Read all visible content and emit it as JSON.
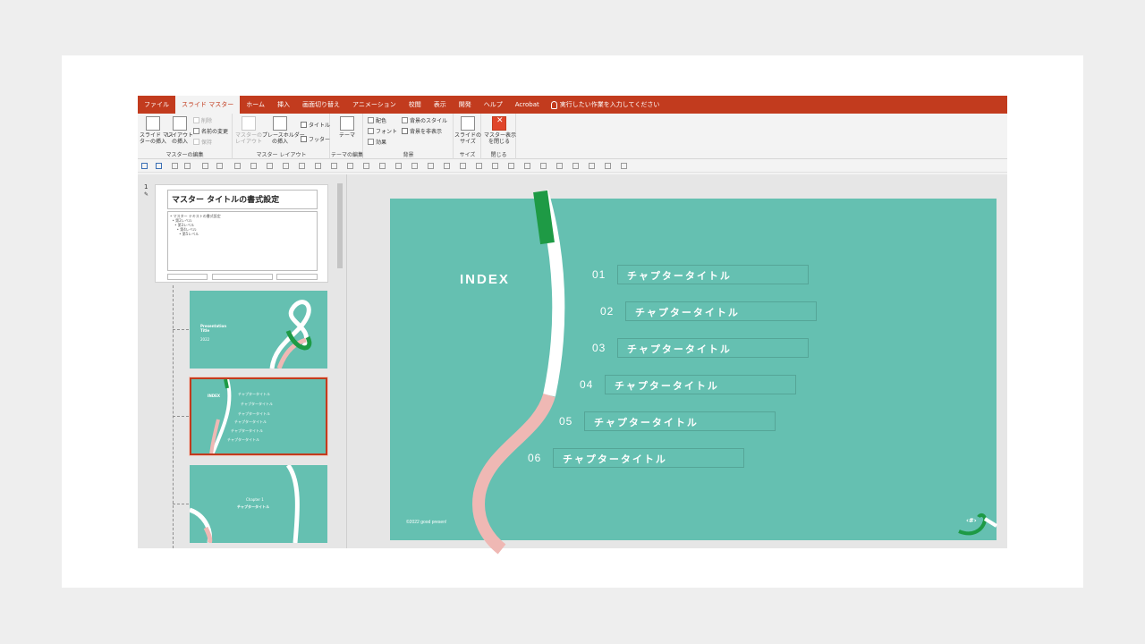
{
  "tabs": [
    {
      "label": "ファイル",
      "active": false
    },
    {
      "label": "スライド マスター",
      "active": true
    },
    {
      "label": "ホーム",
      "active": false
    },
    {
      "label": "挿入",
      "active": false
    },
    {
      "label": "画面切り替え",
      "active": false
    },
    {
      "label": "アニメーション",
      "active": false
    },
    {
      "label": "校閲",
      "active": false
    },
    {
      "label": "表示",
      "active": false
    },
    {
      "label": "開発",
      "active": false
    },
    {
      "label": "ヘルプ",
      "active": false
    },
    {
      "label": "Acrobat",
      "active": false
    }
  ],
  "tell_me": "実行したい作業を入力してください",
  "ribbon": {
    "master_edit": {
      "label": "マスターの編集",
      "insert_master": "スライド マス\nターの挿入",
      "insert_layout": "レイアウト\nの挿入",
      "delete": "削除",
      "rename": "名前の変更",
      "preserve": "保持"
    },
    "master_layout": {
      "label": "マスター レイアウト",
      "master_layout_btn": "マスターの\nレイアウト",
      "insert_placeholder": "プレースホルダー\nの挿入",
      "title": "タイトル",
      "footer": "フッター"
    },
    "theme_edit": {
      "label": "テーマの編集",
      "theme": "テーマ"
    },
    "background": {
      "label": "背景",
      "colors": "配色",
      "fonts": "フォント",
      "effects": "効果",
      "bg_styles": "背景のスタイル",
      "hide_bg": "背景を非表示"
    },
    "size": {
      "label": "サイズ",
      "slide_size": "スライドの\nサイズ"
    },
    "close": {
      "label": "閉じる",
      "close_master": "マスター表示\nを閉じる"
    }
  },
  "slide_panel": {
    "number": "1",
    "master_title": "マスター タイトルの書式設定",
    "master_body": [
      "• マスター テキストの書式設定",
      "  • 第2レベル",
      "    • 第3レベル",
      "      • 第4レベル",
      "        • 第5レベル"
    ],
    "thumb1": {
      "title": "Presentation\nTitle",
      "sub": "2022"
    },
    "thumb2": {
      "index": "INDEX",
      "chapter_label": "チャプタータイトル"
    },
    "thumb3": {
      "chapter": "Chapter 1",
      "title": "チャプタータイトル"
    }
  },
  "slide": {
    "index_title": "INDEX",
    "chapters": [
      {
        "num": "01",
        "title": "チャプタータイトル"
      },
      {
        "num": "02",
        "title": "チャプタータイトル"
      },
      {
        "num": "03",
        "title": "チャプタータイトル"
      },
      {
        "num": "04",
        "title": "チャプタータイトル"
      },
      {
        "num": "05",
        "title": "チャプタータイトル"
      },
      {
        "num": "06",
        "title": "チャプタータイトル"
      }
    ],
    "copyright": "©2022 good presen!",
    "page_mark": "‹#›"
  },
  "colors": {
    "ribbon_red": "#c23b1e",
    "slide_teal": "#65c0b1",
    "accent_green": "#1e9a45",
    "accent_pink": "#efb8b4"
  }
}
